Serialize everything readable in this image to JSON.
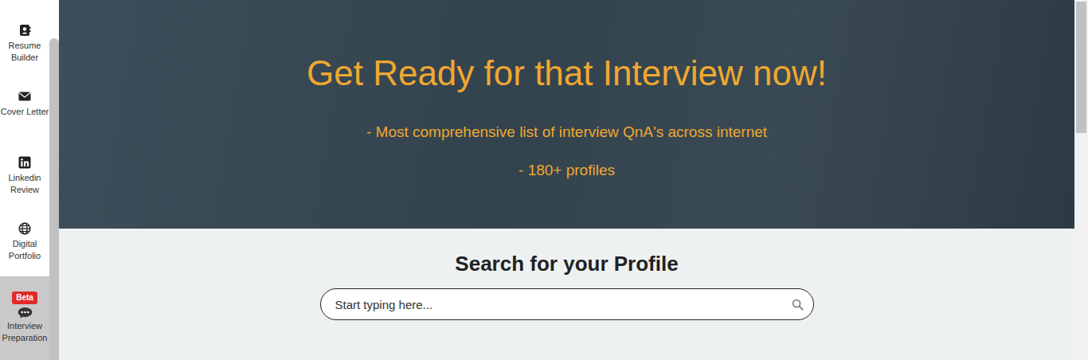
{
  "sidebar": {
    "items": [
      {
        "label": "Resume Builder",
        "selected": false
      },
      {
        "label": "Cover Letter",
        "selected": false
      },
      {
        "label": "Linkedin Review",
        "selected": false
      },
      {
        "label": "Digital Portfolio",
        "selected": false
      },
      {
        "label": "Interview Preparation",
        "selected": true,
        "badge": "Beta"
      }
    ]
  },
  "hero": {
    "title": "Get Ready for that Interview now!",
    "lines": [
      "- Most comprehensive list of interview QnA's across internet",
      "- 180+ profiles"
    ]
  },
  "search": {
    "heading": "Search for your Profile",
    "placeholder": "Start typing here..."
  }
}
